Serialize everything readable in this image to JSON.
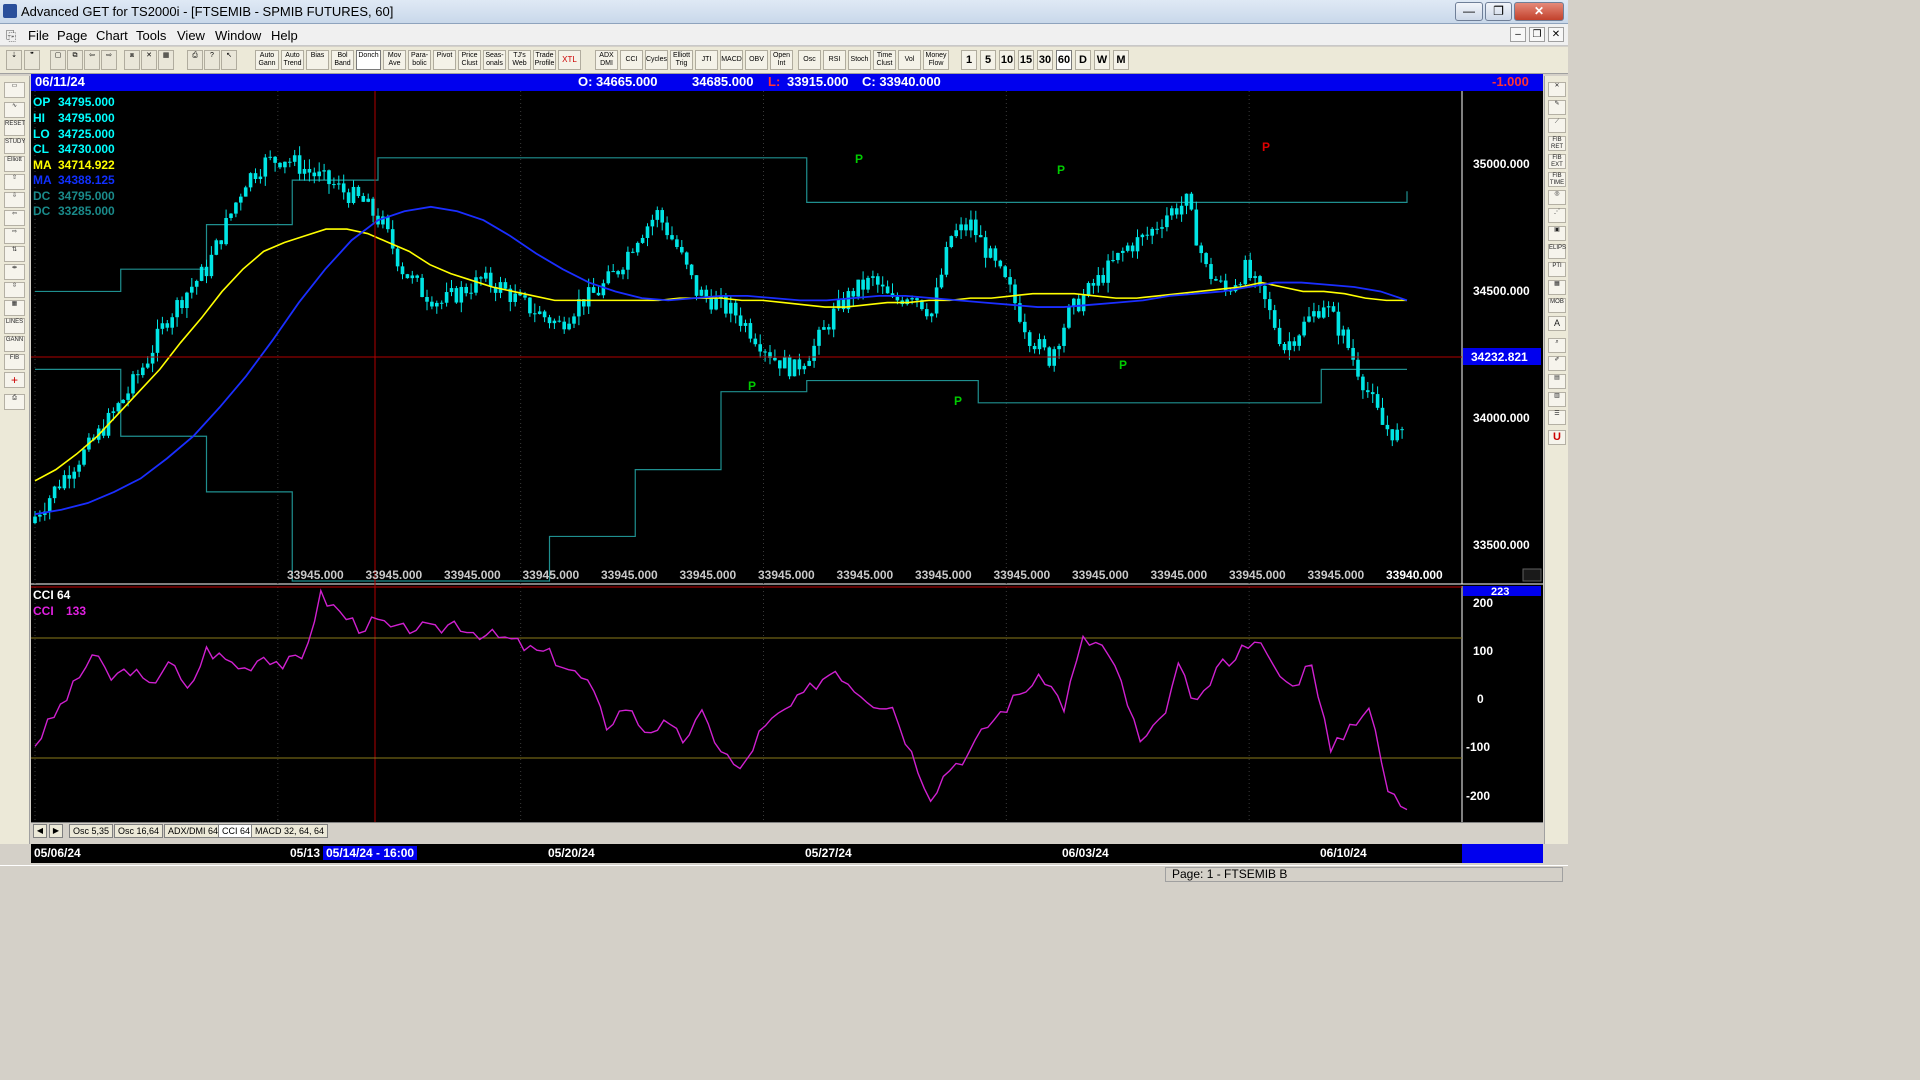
{
  "window": {
    "title": "Advanced GET for TS2000i - [FTSEMIB - SPMIB FUTURES, 60]",
    "minimize": "—",
    "maximize": "❐",
    "close": "✕"
  },
  "menu": {
    "items": [
      "File",
      "Page",
      "Chart",
      "Tools",
      "View",
      "Window",
      "Help"
    ],
    "mdi": [
      "–",
      "❐",
      "✕"
    ]
  },
  "toolbar": {
    "buttons": [
      "Auto Gann",
      "Auto Trend",
      "Bias",
      "Bol Band",
      "Donch",
      "Mov Ave",
      "Para- bolic",
      "Pivot",
      "Price Clust",
      "Seas- onals",
      "TJ's Web",
      "Trade Profile",
      "XTL",
      "ADX DMI",
      "CCI",
      "Cycles",
      "Elliott Trig",
      "JTI",
      "MACD",
      "OBV",
      "Open Int",
      "Osc",
      "RSI",
      "Stoch",
      "Time Clust",
      "Vol",
      "Money Flow"
    ],
    "periods": [
      "1",
      "5",
      "10",
      "15",
      "30",
      "60",
      "D",
      "W",
      "M"
    ],
    "selected_period": "60"
  },
  "header": {
    "date": "06/11/24",
    "open": "O: 34665.000",
    "high": "34685.000",
    "low_label": "L:",
    "low": "33915.000",
    "close": "C: 33940.000",
    "change": "-1.000"
  },
  "legend": [
    {
      "label": "OP",
      "value": "34795.000",
      "color": "#00ffff"
    },
    {
      "label": "HI",
      "value": "34795.000",
      "color": "#00ffff"
    },
    {
      "label": "LO",
      "value": "34725.000",
      "color": "#00ffff"
    },
    {
      "label": "CL",
      "value": "34730.000",
      "color": "#00ffff"
    },
    {
      "label": "MA",
      "value": "34714.922",
      "color": "#ffff00"
    },
    {
      "label": "MA",
      "value": "34388.125",
      "color": "#1030ff"
    },
    {
      "label": "DC",
      "value": "34795.000",
      "color": "#1a8a8a"
    },
    {
      "label": "DC",
      "value": "33285.000",
      "color": "#1a8a8a"
    }
  ],
  "price_axis": {
    "labels": [
      "35000.000",
      "34500.000",
      "34000.000",
      "33500.000"
    ],
    "current_price": "34232.821"
  },
  "bottom_values": [
    "33945.000",
    "33945.000",
    "33945.000",
    "33945.000",
    "33945.000",
    "33945.000",
    "33945.000",
    "33945.000",
    "33945.000",
    "33945.000",
    "33945.000",
    "33945.000",
    "33945.000",
    "33945.000",
    "33940.000"
  ],
  "pivot_labels": [
    "P",
    "P",
    "P",
    "P",
    "P",
    "P",
    "P"
  ],
  "cci": {
    "label1": "CCI 64",
    "label2": "CCI",
    "value2": "133",
    "readout": "223",
    "axis": [
      "200",
      "100",
      "0",
      "-100",
      "-200"
    ]
  },
  "pane_tabs": [
    "Osc 5,35",
    "Osc 16,64",
    "ADX/DMI 64",
    "CCI 64",
    "MACD 32, 64, 64"
  ],
  "active_tab": "CCI 64",
  "dates": [
    "05/06/24",
    "05/13",
    "05/14/24 - 16:00",
    "05/20/24",
    "05/27/24",
    "06/03/24",
    "06/10/24"
  ],
  "status": "Page: 1 - FTSEMIB B",
  "colors": {
    "chart_bg": "#000000",
    "candle": "#00e5e5",
    "ma_fast": "#ffff00",
    "ma_slow": "#1a2eff",
    "donchian": "#1f8f8f",
    "cci_line": "#d020d0",
    "cursor_line": "#b00000",
    "header_bg": "#0000ee",
    "pivot_green": "#00cc00",
    "pivot_red": "#dd0000"
  },
  "chart_data": {
    "type": "line",
    "title": "FTSEMIB - SPMIB FUTURES, 60",
    "price_ylim": [
      33300,
      35500
    ],
    "x_sessions": [
      "05/06/24",
      "05/13/24",
      "05/20/24",
      "05/27/24",
      "06/03/24",
      "06/10/24"
    ],
    "close_series": [
      33560,
      33680,
      33800,
      33900,
      34020,
      34150,
      34300,
      34480,
      34600,
      34700,
      34900,
      35100,
      35180,
      35200,
      35150,
      35100,
      35050,
      35000,
      34900,
      34700,
      34600,
      34550,
      34600,
      34650,
      34620,
      34550,
      34500,
      34450,
      34550,
      34600,
      34700,
      34850,
      34950,
      34800,
      34600,
      34550,
      34500,
      34400,
      34300,
      34250,
      34350,
      34500,
      34600,
      34650,
      34550,
      34600,
      34500,
      34850,
      34900,
      34750,
      34600,
      34400,
      34300,
      34500,
      34600,
      34700,
      34800,
      34850,
      34950,
      35000,
      34700,
      34600,
      34700,
      34550,
      34350,
      34450,
      34550,
      34400,
      34200,
      34000,
      33940
    ],
    "ma_fast_series": [
      33750,
      33800,
      33870,
      33950,
      34050,
      34150,
      34250,
      34370,
      34480,
      34600,
      34700,
      34780,
      34820,
      34850,
      34880,
      34880,
      34860,
      34820,
      34780,
      34720,
      34680,
      34650,
      34620,
      34600,
      34580,
      34560,
      34560,
      34560,
      34560,
      34560,
      34560,
      34570,
      34570,
      34570,
      34560,
      34560,
      34550,
      34540,
      34530,
      34530,
      34540,
      34550,
      34550,
      34560,
      34560,
      34570,
      34570,
      34580,
      34590,
      34590,
      34590,
      34580,
      34570,
      34570,
      34580,
      34590,
      34600,
      34610,
      34620,
      34640,
      34620,
      34600,
      34600,
      34590,
      34570,
      34560,
      34560
    ],
    "ma_slow_series": [
      33600,
      33620,
      33650,
      33700,
      33760,
      33850,
      33950,
      34080,
      34220,
      34380,
      34550,
      34700,
      34830,
      34920,
      34960,
      34980,
      34960,
      34920,
      34850,
      34770,
      34700,
      34640,
      34600,
      34570,
      34560,
      34570,
      34580,
      34580,
      34570,
      34560,
      34560,
      34570,
      34580,
      34580,
      34570,
      34560,
      34550,
      34540,
      34530,
      34530,
      34540,
      34550,
      34560,
      34580,
      34590,
      34600,
      34620,
      34640,
      34640,
      34630,
      34620,
      34600,
      34560
    ],
    "donchian_upper": [
      34600,
      34700,
      34900,
      35100,
      35200,
      35200,
      35200,
      35200,
      35200,
      35000,
      35000,
      35000,
      35000,
      35000,
      35000,
      35000,
      35050
    ],
    "donchian_lower": [
      34250,
      33950,
      33700,
      33300,
      33300,
      33300,
      33500,
      33800,
      34150,
      34200,
      34200,
      34100,
      34100,
      34100,
      34100,
      34250,
      34250
    ],
    "cci_ylim": [
      -260,
      230
    ],
    "cci_series": [
      -100,
      -40,
      20,
      90,
      40,
      60,
      20,
      80,
      10,
      100,
      80,
      60,
      90,
      70,
      80,
      215,
      180,
      150,
      160,
      140,
      150,
      140,
      160,
      140,
      130,
      120,
      100,
      90,
      60,
      30,
      -60,
      -20,
      -70,
      -60,
      -90,
      -40,
      -110,
      -160,
      -80,
      -40,
      -10,
      30,
      60,
      20,
      -10,
      -20,
      -120,
      -210,
      -150,
      -120,
      -60,
      -20,
      20,
      40,
      -20,
      120,
      110,
      30,
      -100,
      -60,
      60,
      -20,
      60,
      90,
      130,
      60,
      20,
      80,
      -120,
      -60,
      -20,
      -200,
      -240
    ]
  }
}
